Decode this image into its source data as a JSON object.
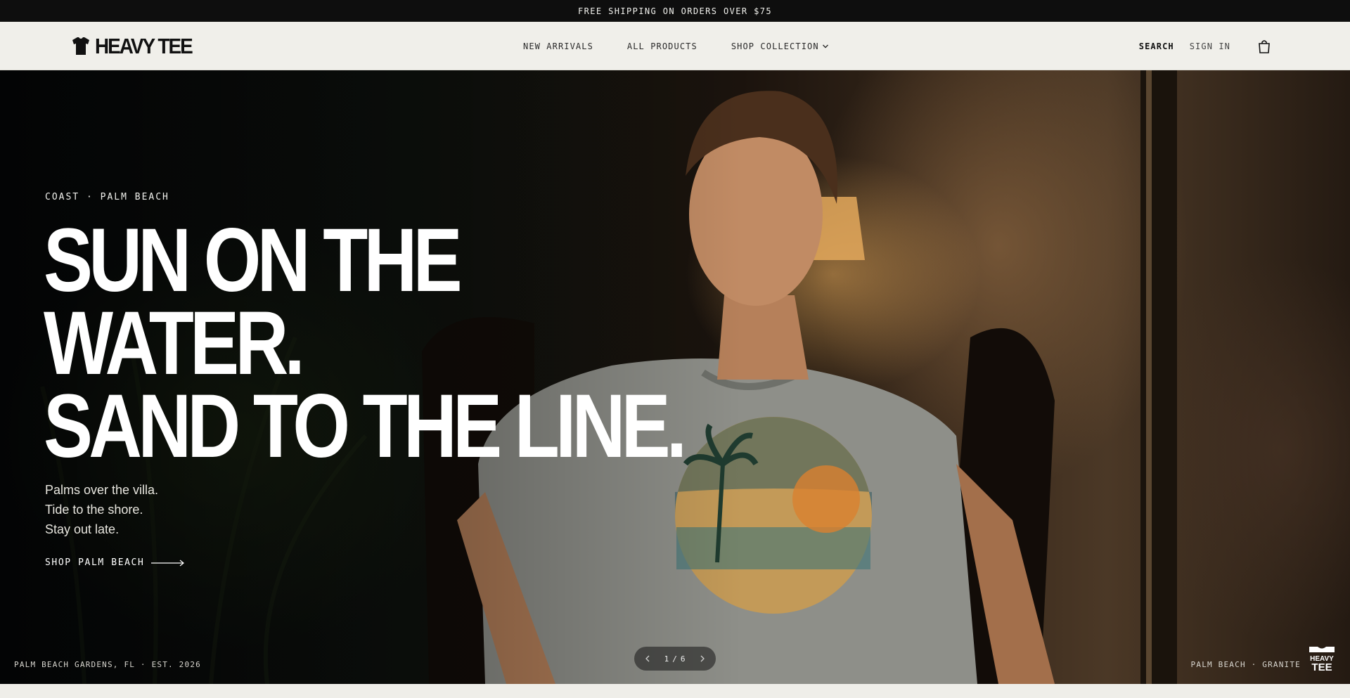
{
  "announcement": "FREE SHIPPING ON ORDERS OVER $75",
  "brand": {
    "name": "HEAVY TEE"
  },
  "nav": {
    "items": [
      "NEW ARRIVALS",
      "ALL PRODUCTS",
      "SHOP COLLECTION"
    ]
  },
  "header_actions": {
    "search": "SEARCH",
    "sign_in": "SIGN IN",
    "cart_icon": "shopping-bag-icon"
  },
  "hero": {
    "eyebrow": "COAST · PALM BEACH",
    "headline": [
      "SUN ON THE",
      "WATER.",
      "SAND TO THE LINE."
    ],
    "subcopy": [
      "Palms over the villa.",
      "Tide to the shore.",
      "Stay out late."
    ],
    "cta": "SHOP PALM BEACH",
    "location": "PALM BEACH GARDENS, FL · EST. 2026",
    "pager": {
      "current": "1",
      "separator": "/",
      "total": "6"
    },
    "variant": "PALM BEACH · GRANITE",
    "badge_lines": [
      "HEAVY",
      "TEE"
    ]
  },
  "colors": {
    "topbar": "#0e0e0e",
    "header": "#f0efea",
    "text_light": "#ffffff"
  }
}
